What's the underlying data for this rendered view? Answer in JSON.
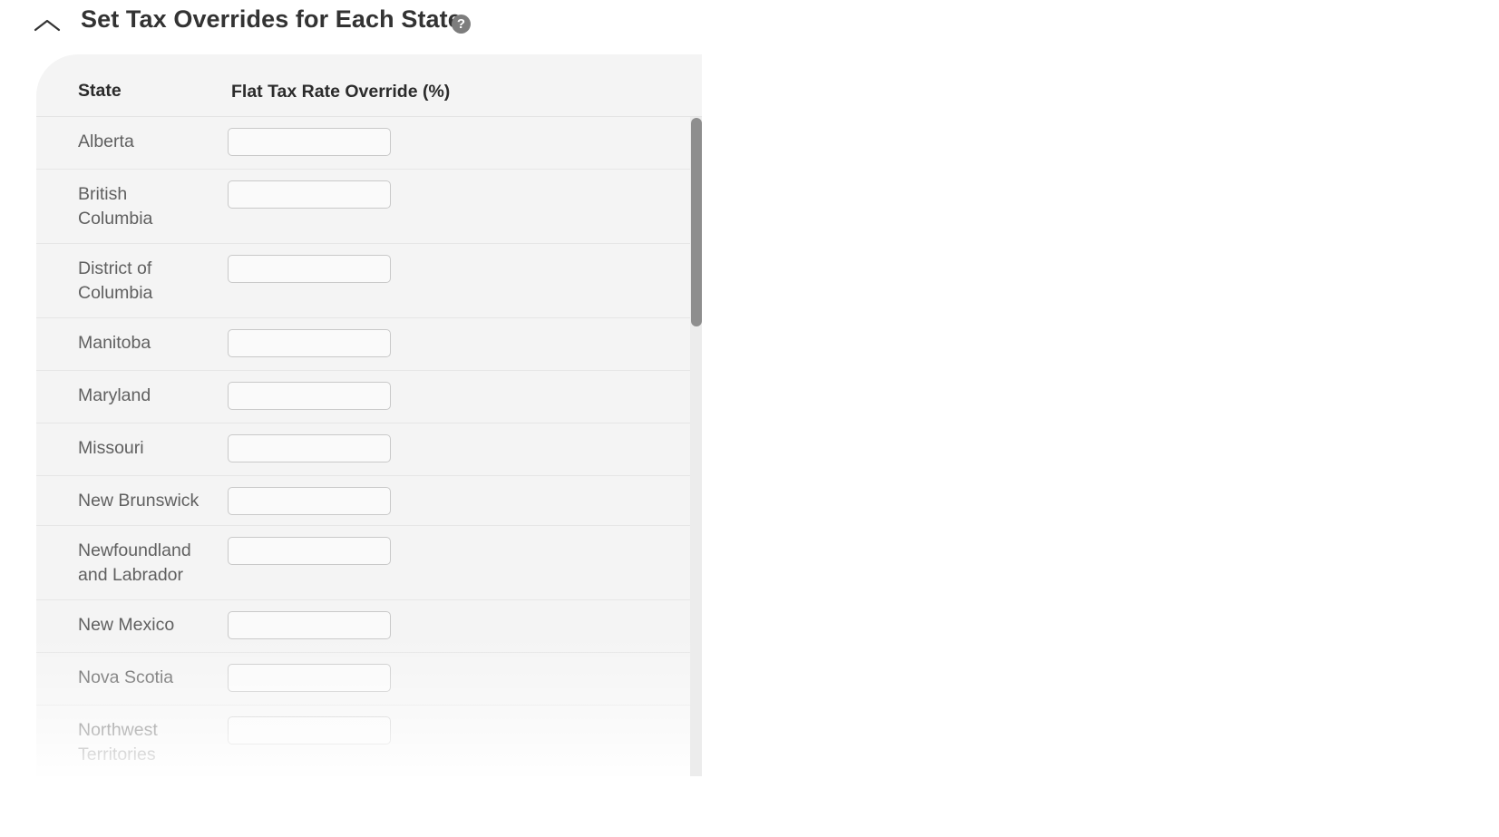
{
  "section": {
    "title": "Set Tax Overrides for Each State",
    "help_icon": "?",
    "toggle_icon": "chevron-up-icon"
  },
  "table": {
    "headers": {
      "state": "State",
      "rate": "Flat Tax Rate Override (%)"
    },
    "rows": [
      {
        "state": "Alberta",
        "value": ""
      },
      {
        "state": "British Columbia",
        "value": ""
      },
      {
        "state": "District of Columbia",
        "value": ""
      },
      {
        "state": "Manitoba",
        "value": ""
      },
      {
        "state": "Maryland",
        "value": ""
      },
      {
        "state": "Missouri",
        "value": ""
      },
      {
        "state": "New Brunswick",
        "value": ""
      },
      {
        "state": "Newfoundland and Labrador",
        "value": ""
      },
      {
        "state": "New Mexico",
        "value": ""
      },
      {
        "state": "Nova Scotia",
        "value": ""
      },
      {
        "state": "Northwest Territories",
        "value": ""
      }
    ]
  },
  "colors": {
    "panel_bg": "#f4f4f4",
    "title_text": "#333333",
    "state_text": "#606060",
    "scroll_thumb": "#8e8e8e"
  }
}
